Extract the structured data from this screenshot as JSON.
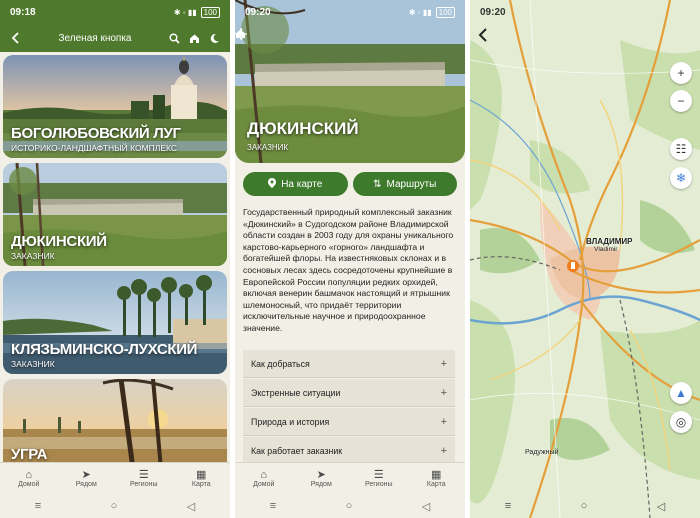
{
  "screens": {
    "list": {
      "status": {
        "time": "09:18",
        "battery": "100"
      },
      "appbar_title": "Зеленая кнопка",
      "cards": [
        {
          "name": "БОГОЛЮБОВСКИЙ ЛУГ",
          "subtitle": "ИСТОРИКО-ЛАНДШАФТНЫЙ КОМПЛЕКС"
        },
        {
          "name": "ДЮКИНСКИЙ",
          "subtitle": "ЗАКАЗНИК"
        },
        {
          "name": "КЛЯЗЬМИНСКО-ЛУХСКИЙ",
          "subtitle": "ЗАКАЗНИК"
        },
        {
          "name": "УГРА",
          "subtitle": ""
        }
      ],
      "bottom_nav": [
        "Домой",
        "Рядом",
        "Регионы",
        "Карта"
      ]
    },
    "detail": {
      "status": {
        "time": "09:20",
        "battery": "100"
      },
      "name": "ДЮКИНСКИЙ",
      "subtitle": "ЗАКАЗНИК",
      "btn_map": "На карте",
      "btn_routes": "Маршруты",
      "description": "Государственный природный комплексный заказник «Дюкинский» в Судогодском районе Владимирской области создан в 2003 году для охраны уникального карстово-карьерного «горного» ландшафта и богатейшей флоры. На известняковых склонах и в сосновых лесах здесь сосредоточены крупнейшие в Европейской России популяции редких орхидей, включая венерин башмачок настоящий и ятрышник шлемоносный, что придаёт территории исключительные научное и природоохранное значение.",
      "accordion": [
        "Как добраться",
        "Экстренные ситуации",
        "Природа и история",
        "Как работает заказник"
      ],
      "bottom_nav": [
        "Домой",
        "Рядом",
        "Регионы",
        "Карта"
      ]
    },
    "map": {
      "status": {
        "time": "09:20"
      },
      "city_label": "ВЛАДИМИР",
      "city_sublabel": "Vladimir",
      "town_label": "Радужный"
    }
  },
  "colors": {
    "primary": "#4f7a2d",
    "button": "#3e7a2c",
    "background": "#f2f0e6"
  },
  "icons": [
    "back-icon",
    "search-icon",
    "home-icon",
    "moon-icon",
    "sun-icon",
    "map-pin-icon",
    "routes-icon",
    "plus-icon",
    "minus-icon",
    "filter-icon",
    "snowflake-icon",
    "compass-icon",
    "locate-icon"
  ]
}
